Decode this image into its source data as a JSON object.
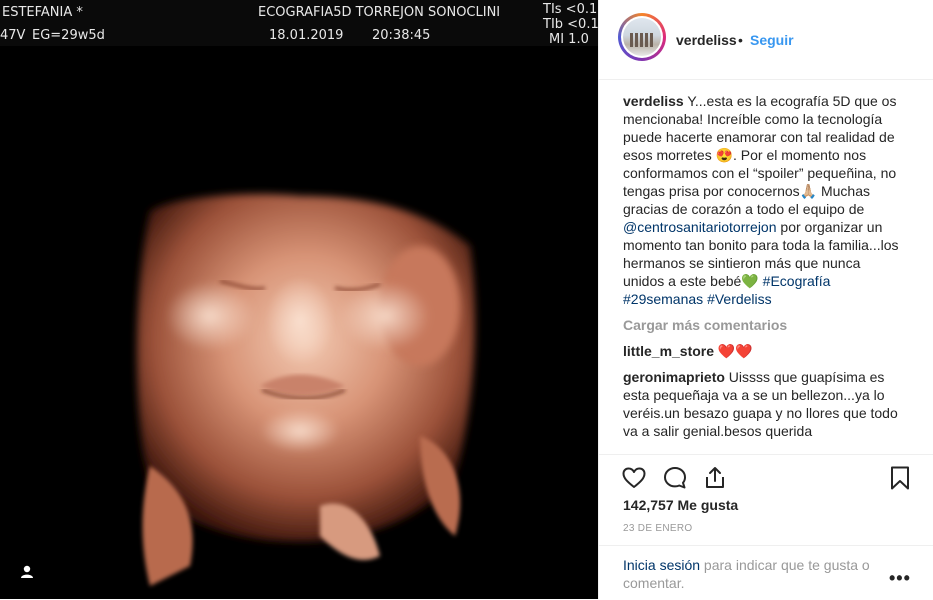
{
  "ultrasound": {
    "patient": "ESTEFANIA  *",
    "clinic": "ECOGRAFIA5D TORREJON SONOCLINI",
    "probe": "47V",
    "gestational_age": "EG=29w5d",
    "date": "18.01.2019",
    "time": "20:38:45",
    "tis": "TIs <0.1",
    "tib": "TIb <0.1",
    "mi": "MI  1.0"
  },
  "post": {
    "username": "verdeliss",
    "dot": "•",
    "follow_label": "Seguir",
    "caption_user": "verdeliss",
    "caption_part1": " Y...esta es la ecografía 5D que os mencionaba! Increíble como la tecnología puede hacerte enamorar con tal realidad de esos morretes 😍. Por el momento nos conformamos con el “spoiler” pequeñina, no tengas prisa por conocernos🙏🏼 Muchas gracias de corazón a todo el equipo de ",
    "caption_mention": "@centrosanitariotorrejon",
    "caption_part2": " por organizar un momento tan bonito para toda la familia...los hermanos se sintieron más que nunca unidos a este bebé",
    "caption_green_heart": "💚",
    "hashtag1": "#Ecografía",
    "hashtag2": "#29semanas",
    "hashtag3": "#Verdeliss",
    "load_more": "Cargar más comentarios",
    "comments": [
      {
        "user": "little_m_store",
        "text": " ❤️❤️"
      },
      {
        "user": "geronimaprieto",
        "text": " Uissss que guapísima es esta pequeñaja va a se un bellezon...ya lo veréis.un besazo guapa y no llores que todo va a salir genial.besos querida"
      }
    ],
    "likes": "142,757 Me gusta",
    "date": "23 DE ENERO",
    "login_link": "Inicia sesión",
    "login_text": " para indicar que te gusta o comentar.",
    "more_options": "•••"
  },
  "icons": {
    "like": "heart-outline-icon",
    "comment": "speech-bubble-icon",
    "share": "share-upload-icon",
    "save": "bookmark-icon",
    "user_tag": "user-silhouette-icon"
  },
  "colors": {
    "link": "#003569",
    "follow": "#3897f0",
    "muted": "#999999",
    "text": "#262626"
  }
}
